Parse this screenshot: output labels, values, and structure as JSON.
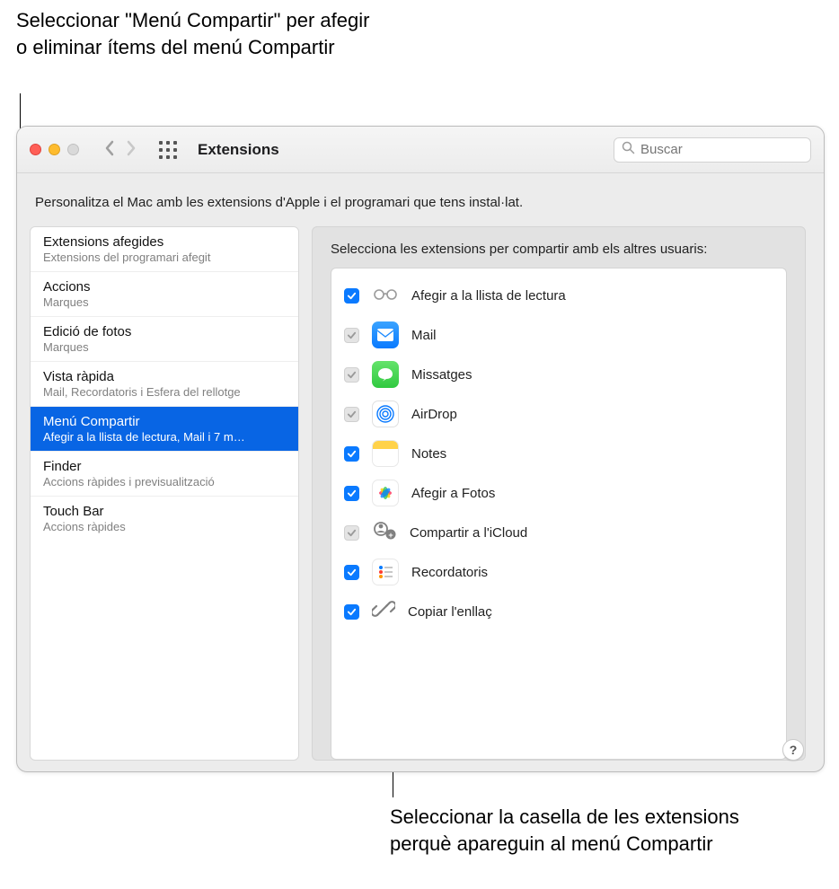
{
  "annotations": {
    "top": "Seleccionar \"Menú Compartir\" per afegir o eliminar ítems del menú Compartir",
    "bottom": "Seleccionar la casella de les extensions perquè apareguin al menú Compartir"
  },
  "toolbar": {
    "title": "Extensions",
    "search_placeholder": "Buscar"
  },
  "intro": "Personalitza el Mac amb les extensions d'Apple i el programari que tens instal·lat.",
  "sidebar": {
    "items": [
      {
        "title": "Extensions afegides",
        "subtitle": "Extensions del programari afegit",
        "selected": false
      },
      {
        "title": "Accions",
        "subtitle": "Marques",
        "selected": false
      },
      {
        "title": "Edició de fotos",
        "subtitle": "Marques",
        "selected": false
      },
      {
        "title": "Vista ràpida",
        "subtitle": "Mail, Recordatoris i Esfera del rellotge",
        "selected": false
      },
      {
        "title": "Menú Compartir",
        "subtitle": "Afegir a la llista de lectura, Mail i 7 m…",
        "selected": true
      },
      {
        "title": "Finder",
        "subtitle": "Accions ràpides i previsualització",
        "selected": false
      },
      {
        "title": "Touch Bar",
        "subtitle": "Accions ràpides",
        "selected": false
      }
    ]
  },
  "main": {
    "heading": "Selecciona les extensions per compartir amb els altres usuaris:",
    "extensions": [
      {
        "label": "Afegir a la llista de lectura",
        "checked": true,
        "disabled": false,
        "icon": "glasses"
      },
      {
        "label": "Mail",
        "checked": true,
        "disabled": true,
        "icon": "mail"
      },
      {
        "label": "Missatges",
        "checked": true,
        "disabled": true,
        "icon": "messages"
      },
      {
        "label": "AirDrop",
        "checked": true,
        "disabled": true,
        "icon": "airdrop"
      },
      {
        "label": "Notes",
        "checked": true,
        "disabled": false,
        "icon": "notes"
      },
      {
        "label": "Afegir a Fotos",
        "checked": true,
        "disabled": false,
        "icon": "photos"
      },
      {
        "label": "Compartir a l'iCloud",
        "checked": true,
        "disabled": true,
        "icon": "icloud"
      },
      {
        "label": "Recordatoris",
        "checked": true,
        "disabled": false,
        "icon": "reminders"
      },
      {
        "label": "Copiar l'enllaç",
        "checked": true,
        "disabled": false,
        "icon": "link"
      }
    ]
  },
  "help_label": "?"
}
